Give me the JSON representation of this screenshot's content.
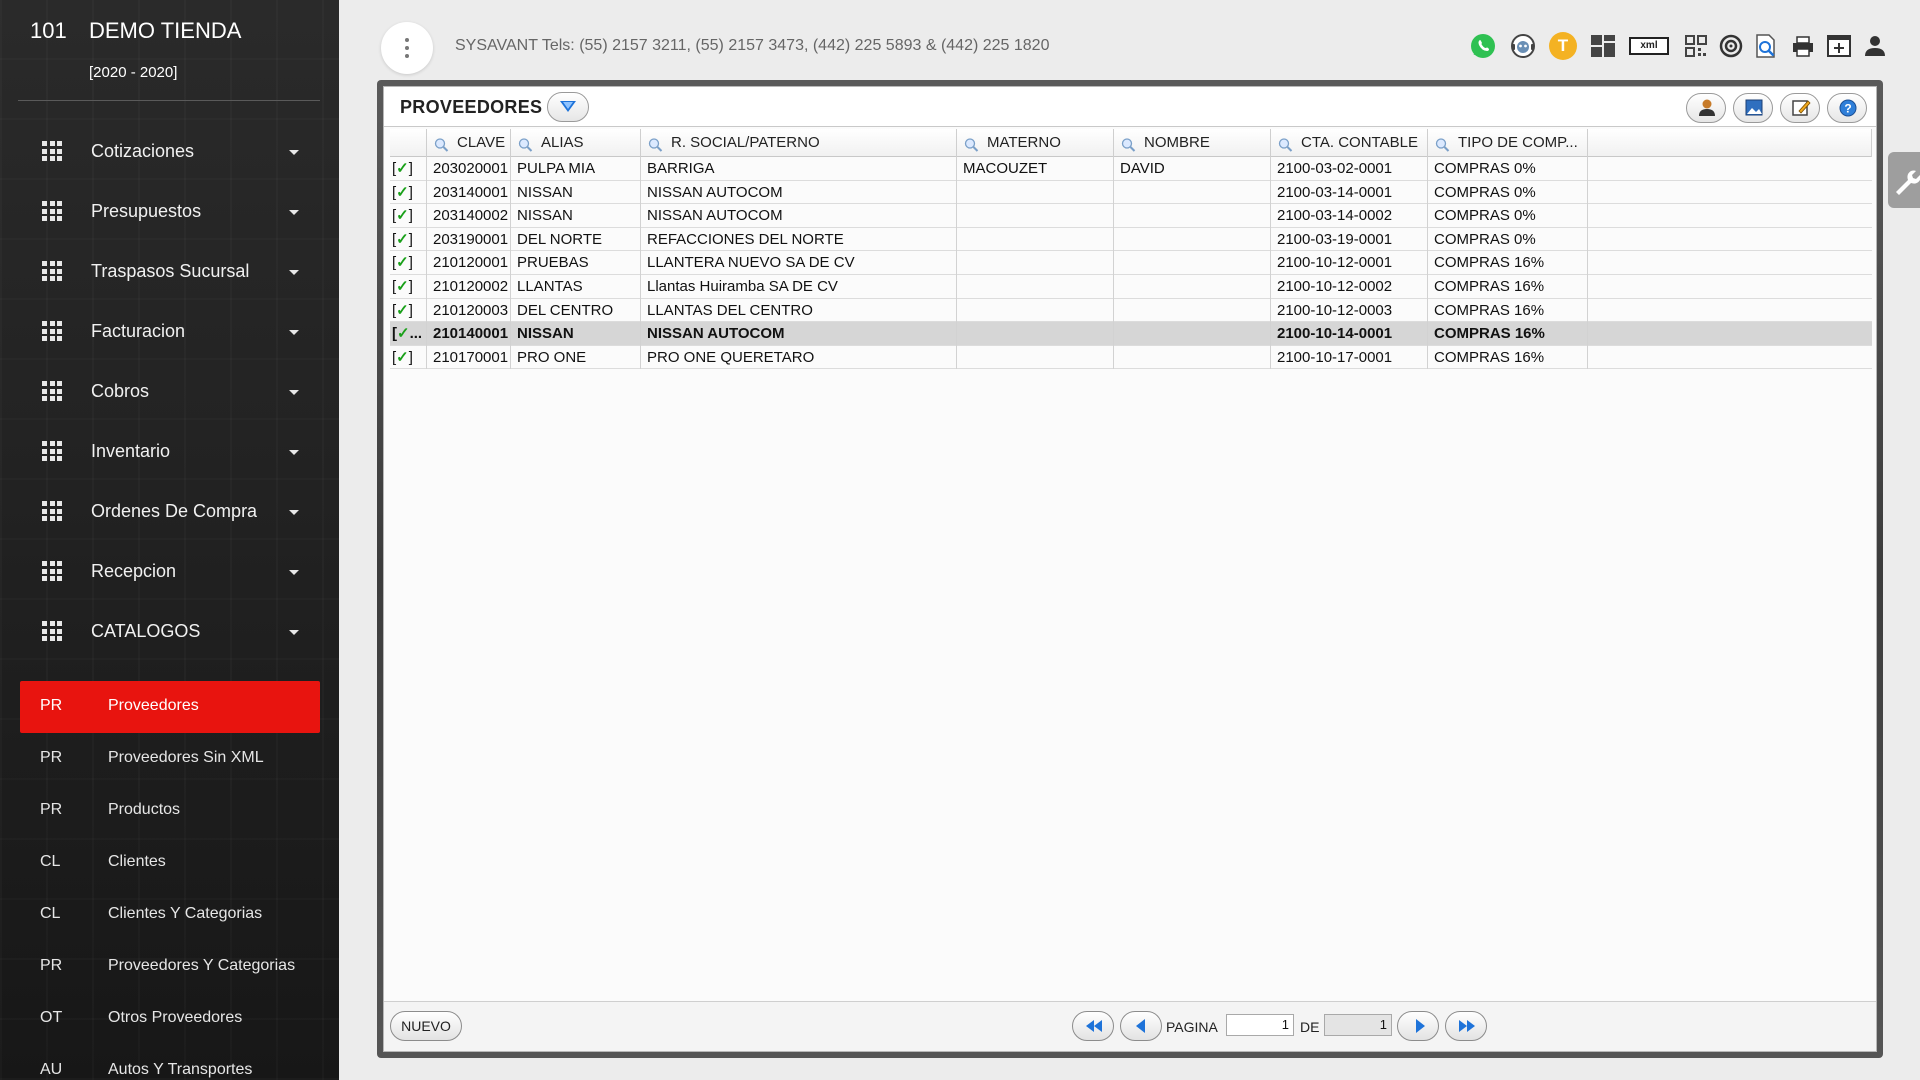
{
  "brand": {
    "code": "101",
    "name": "DEMO TIENDA",
    "years": "[2020 - 2020]"
  },
  "menu": [
    {
      "label": "Cotizaciones",
      "name": "cotizaciones"
    },
    {
      "label": "Presupuestos",
      "name": "presupuestos"
    },
    {
      "label": "Traspasos Sucursal",
      "name": "traspasos-sucursal"
    },
    {
      "label": "Facturacion",
      "name": "facturacion"
    },
    {
      "label": "Cobros",
      "name": "cobros"
    },
    {
      "label": "Inventario",
      "name": "inventario"
    },
    {
      "label": "Ordenes De Compra",
      "name": "ordenes-de-compra"
    },
    {
      "label": "Recepcion",
      "name": "recepcion"
    },
    {
      "label": "CATALOGOS",
      "name": "catalogos"
    }
  ],
  "submenu": [
    {
      "abbr": "PR",
      "label": "Proveedores",
      "name": "proveedores",
      "active": true
    },
    {
      "abbr": "PR",
      "label": "Proveedores Sin XML",
      "name": "proveedores-sin-xml"
    },
    {
      "abbr": "PR",
      "label": "Productos",
      "name": "productos"
    },
    {
      "abbr": "CL",
      "label": "Clientes",
      "name": "clientes"
    },
    {
      "abbr": "CL",
      "label": "Clientes Y Categorias",
      "name": "clientes-y-categorias"
    },
    {
      "abbr": "PR",
      "label": "Proveedores Y Categorias",
      "name": "proveedores-y-categorias"
    },
    {
      "abbr": "OT",
      "label": "Otros Proveedores",
      "name": "otros-proveedores"
    },
    {
      "abbr": "AU",
      "label": "Autos Y Transportes",
      "name": "autos-y-transportes"
    }
  ],
  "topbar": {
    "tels": "SYSAVANT Tels: (55) 2157 3211, (55) 2157 3473, (442) 225 5893 & (442) 225 1820",
    "icons": [
      "whatsapp-icon",
      "support-chat-icon",
      "t-badge-icon",
      "dashboard-tiles-icon",
      "xml-icon",
      "qr-code-icon",
      "target-icon",
      "search-document-icon",
      "printer-icon",
      "add-window-icon",
      "user-icon"
    ],
    "t_badge": "T",
    "xml_label": "xml"
  },
  "panel": {
    "title": "PROVEEDORES",
    "header_buttons": [
      "contact-icon",
      "image-icon",
      "edit-icon",
      "help-icon"
    ]
  },
  "table": {
    "columns": [
      "CLAVE",
      "ALIAS",
      "R. SOCIAL/PATERNO",
      "MATERNO",
      "NOMBRE",
      "CTA. CONTABLE",
      "TIPO DE COMP..."
    ],
    "rows": [
      {
        "check": "[✓]",
        "clave": "203020001",
        "alias": "PULPA MIA",
        "social": "BARRIGA",
        "materno": "MACOUZET",
        "nombre": "DAVID",
        "cta": "2100-03-02-0001",
        "tipo": "COMPRAS 0%"
      },
      {
        "check": "[✓]",
        "clave": "203140001",
        "alias": "NISSAN",
        "social": "NISSAN AUTOCOM",
        "materno": "",
        "nombre": "",
        "cta": "2100-03-14-0001",
        "tipo": "COMPRAS 0%"
      },
      {
        "check": "[✓]",
        "clave": "203140002",
        "alias": "NISSAN",
        "social": "NISSAN AUTOCOM",
        "materno": "",
        "nombre": "",
        "cta": "2100-03-14-0002",
        "tipo": "COMPRAS 0%"
      },
      {
        "check": "[✓]",
        "clave": "203190001",
        "alias": "DEL NORTE",
        "social": "REFACCIONES DEL NORTE",
        "materno": "",
        "nombre": "",
        "cta": "2100-03-19-0001",
        "tipo": "COMPRAS 0%"
      },
      {
        "check": "[✓]",
        "clave": "210120001",
        "alias": "PRUEBAS",
        "social": "LLANTERA NUEVO SA DE CV",
        "materno": "",
        "nombre": "",
        "cta": "2100-10-12-0001",
        "tipo": "COMPRAS 16%"
      },
      {
        "check": "[✓]",
        "clave": "210120002",
        "alias": "LLANTAS",
        "social": "Llantas Huiramba SA DE CV",
        "materno": "",
        "nombre": "",
        "cta": "2100-10-12-0002",
        "tipo": "COMPRAS 16%"
      },
      {
        "check": "[✓]",
        "clave": "210120003",
        "alias": "DEL CENTRO",
        "social": "LLANTAS DEL CENTRO",
        "materno": "",
        "nombre": "",
        "cta": "2100-10-12-0003",
        "tipo": "COMPRAS 16%"
      },
      {
        "check": "[✓...",
        "clave": "210140001",
        "alias": "NISSAN",
        "social": "NISSAN AUTOCOM",
        "materno": "",
        "nombre": "",
        "cta": "2100-10-14-0001",
        "tipo": "COMPRAS 16%",
        "selected": true
      },
      {
        "check": "[✓]",
        "clave": "210170001",
        "alias": "PRO ONE",
        "social": "PRO ONE QUERETARO",
        "materno": "",
        "nombre": "",
        "cta": "2100-10-17-0001",
        "tipo": "COMPRAS 16%"
      }
    ]
  },
  "footer": {
    "new_label": "NUEVO",
    "page_label": "PAGINA",
    "of_label": "DE",
    "page_value": "1",
    "total_pages": "1"
  },
  "colors": {
    "active_menu": "#e8140f",
    "sidebar_bg": "#222222",
    "accent_blue": "#1e73d9"
  }
}
